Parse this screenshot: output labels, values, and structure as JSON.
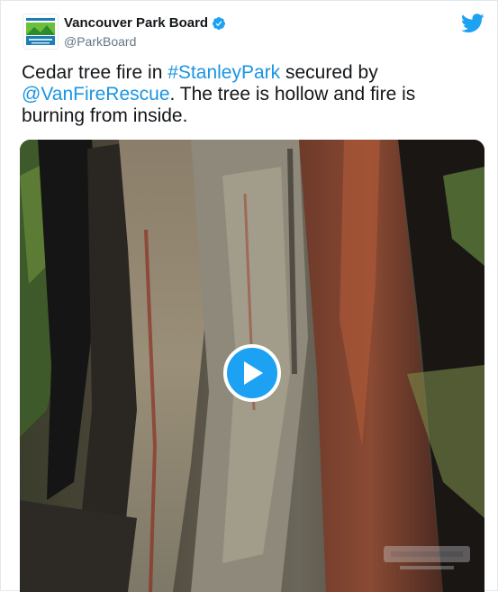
{
  "tweet": {
    "display_name": "Vancouver Park Board",
    "handle": "@ParkBoard",
    "text_1": "Cedar tree fire in ",
    "hashtag": "#StanleyPark",
    "text_2": " secured by",
    "mention": "@VanFireRescue",
    "text_3": ". The tree is hollow and fire is burning from inside."
  },
  "icons": {
    "verified": "verified-badge-icon",
    "brand": "twitter-bird-icon",
    "play": "play-icon"
  },
  "colors": {
    "link": "#1b95e0",
    "twitter_blue": "#1da1f2",
    "verified": "#1da1f2"
  }
}
